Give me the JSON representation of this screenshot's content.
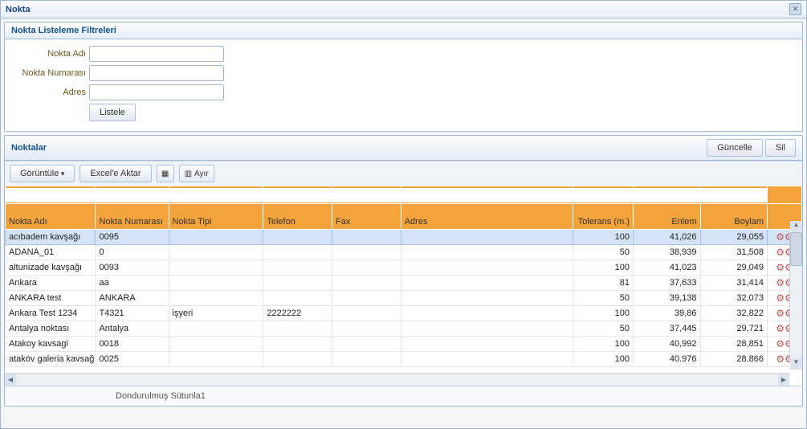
{
  "window": {
    "title": "Nokta"
  },
  "filter_panel": {
    "title": "Nokta Listeleme Filtreleri",
    "fields": {
      "name_label": "Nokta Adı",
      "number_label": "Nokta Numarası",
      "address_label": "Adres",
      "name_value": "",
      "number_value": "",
      "address_value": ""
    },
    "list_button": "Listele"
  },
  "grid_panel": {
    "title": "Noktalar",
    "update_button": "Güncelle",
    "delete_button": "Sil",
    "view_button": "Görüntüle",
    "export_button": "Excel'e Aktar",
    "split_button": "Ayır"
  },
  "columns": {
    "name": "Nokta Adı",
    "number": "Nokta Numarası",
    "type": "Nokta Tipi",
    "phone": "Telefon",
    "fax": "Fax",
    "address": "Adres",
    "tolerance": "Tolerans (m.)",
    "lat": "Enlem",
    "lon": "Boylam"
  },
  "rows": [
    {
      "name": "acıbadem kavşağı",
      "number": "0095",
      "type": "",
      "phone": "",
      "fax": "",
      "address": "",
      "tolerance": "100",
      "lat": "41,026",
      "lon": "29,055"
    },
    {
      "name": "ADANA_01",
      "number": "0",
      "type": "",
      "phone": "",
      "fax": "",
      "address": "",
      "tolerance": "50",
      "lat": "38,939",
      "lon": "31,508"
    },
    {
      "name": "altunizade kavşağı",
      "number": "0093",
      "type": "",
      "phone": "",
      "fax": "",
      "address": "",
      "tolerance": "100",
      "lat": "41,023",
      "lon": "29,049"
    },
    {
      "name": "Ankara",
      "number": "aa",
      "type": "",
      "phone": "",
      "fax": "",
      "address": "",
      "tolerance": "81",
      "lat": "37,633",
      "lon": "31,414"
    },
    {
      "name": "ANKARA test",
      "number": "ANKARA",
      "type": "",
      "phone": "",
      "fax": "",
      "address": "",
      "tolerance": "50",
      "lat": "39,138",
      "lon": "32,073"
    },
    {
      "name": "Ankara Test 1234",
      "number": "T4321",
      "type": "işyeri",
      "phone": "2222222",
      "fax": "",
      "address": "",
      "tolerance": "100",
      "lat": "39,86",
      "lon": "32,822"
    },
    {
      "name": "Antalya noktası",
      "number": "Antalya",
      "type": "",
      "phone": "",
      "fax": "",
      "address": "",
      "tolerance": "50",
      "lat": "37,445",
      "lon": "29,721"
    },
    {
      "name": "Atakoy kavsagi",
      "number": "0018",
      "type": "",
      "phone": "",
      "fax": "",
      "address": "",
      "tolerance": "100",
      "lat": "40,992",
      "lon": "28,851"
    },
    {
      "name": "ataköv galeria kavsağ",
      "number": "0025",
      "type": "",
      "phone": "",
      "fax": "",
      "address": "",
      "tolerance": "100",
      "lat": "40.976",
      "lon": "28.866"
    }
  ],
  "footer": {
    "frozen": "Dondurulmuş Sütunla1"
  }
}
